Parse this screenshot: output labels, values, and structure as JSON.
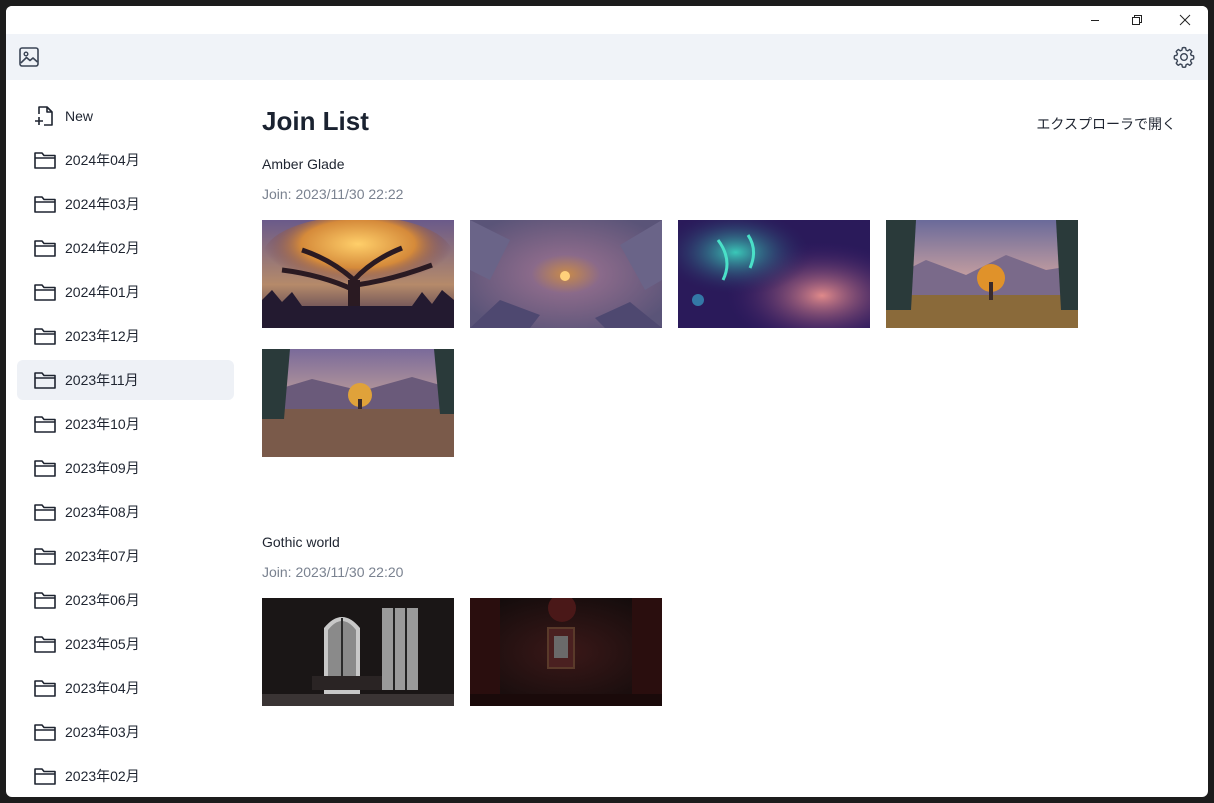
{
  "window": {
    "controls": {
      "minimize_icon": "minimize-icon",
      "maximize_icon": "restore-icon",
      "close_icon": "close-icon"
    }
  },
  "toolbar": {
    "app_icon": "image-icon",
    "settings_icon": "gear-icon"
  },
  "sidebar": {
    "items": [
      {
        "label": "New",
        "icon": "new-file-icon",
        "active": false
      },
      {
        "label": "2024年04月",
        "icon": "folder-icon",
        "active": false
      },
      {
        "label": "2024年03月",
        "icon": "folder-icon",
        "active": false
      },
      {
        "label": "2024年02月",
        "icon": "folder-icon",
        "active": false
      },
      {
        "label": "2024年01月",
        "icon": "folder-icon",
        "active": false
      },
      {
        "label": "2023年12月",
        "icon": "folder-icon",
        "active": false
      },
      {
        "label": "2023年11月",
        "icon": "folder-icon",
        "active": true
      },
      {
        "label": "2023年10月",
        "icon": "folder-icon",
        "active": false
      },
      {
        "label": "2023年09月",
        "icon": "folder-icon",
        "active": false
      },
      {
        "label": "2023年08月",
        "icon": "folder-icon",
        "active": false
      },
      {
        "label": "2023年07月",
        "icon": "folder-icon",
        "active": false
      },
      {
        "label": "2023年06月",
        "icon": "folder-icon",
        "active": false
      },
      {
        "label": "2023年05月",
        "icon": "folder-icon",
        "active": false
      },
      {
        "label": "2023年04月",
        "icon": "folder-icon",
        "active": false
      },
      {
        "label": "2023年03月",
        "icon": "folder-icon",
        "active": false
      },
      {
        "label": "2023年02月",
        "icon": "folder-icon",
        "active": false
      }
    ]
  },
  "main": {
    "title": "Join List",
    "open_explorer_label": "エクスプローラで開く",
    "worlds": [
      {
        "name": "Amber Glade",
        "join": "Join: 2023/11/30 22:22",
        "photo_count": 5
      },
      {
        "name": "Gothic world",
        "join": "Join: 2023/11/30 22:20",
        "photo_count": 2
      }
    ]
  },
  "colors": {
    "toolbar_bg": "#f0f3f8",
    "active_item_bg": "#eef1f6",
    "text": "#1e2430",
    "muted_text": "#7a8290"
  }
}
